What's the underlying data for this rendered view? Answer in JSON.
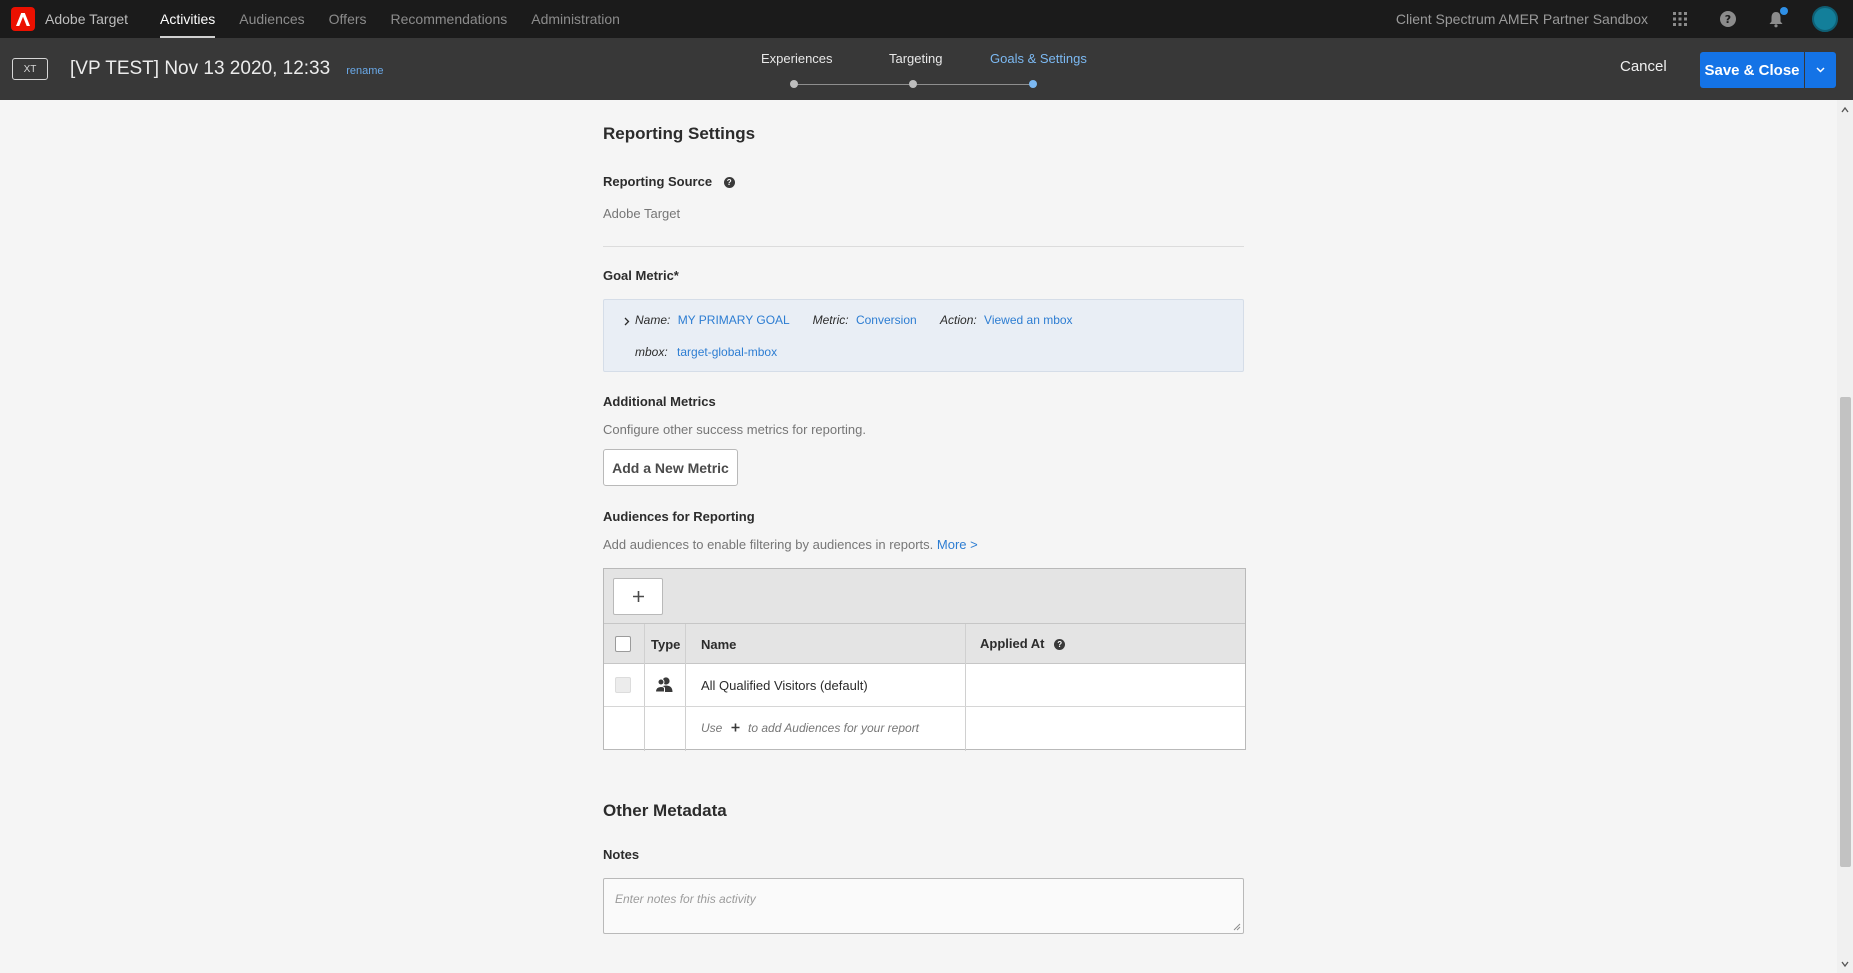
{
  "topbar": {
    "brand": "Adobe Target",
    "nav": [
      "Activities",
      "Audiences",
      "Offers",
      "Recommendations",
      "Administration"
    ],
    "sandbox": "Client Spectrum AMER Partner Sandbox"
  },
  "activity": {
    "badge": "XT",
    "title": "[VP TEST] Nov 13 2020, 12:33",
    "rename": "rename"
  },
  "steps": [
    "Experiences",
    "Targeting",
    "Goals & Settings"
  ],
  "actions": {
    "cancel": "Cancel",
    "save": "Save & Close"
  },
  "reporting": {
    "title": "Reporting Settings",
    "source_label": "Reporting Source",
    "source_value": "Adobe Target",
    "goal_label": "Goal Metric*",
    "goal": {
      "name_key": "Name:",
      "name_val": "MY PRIMARY GOAL",
      "metric_key": "Metric:",
      "metric_val": "Conversion",
      "action_key": "Action:",
      "action_val": "Viewed an mbox",
      "mbox_key": "mbox:",
      "mbox_val": "target-global-mbox"
    },
    "additional_label": "Additional Metrics",
    "additional_desc": "Configure other success metrics for reporting.",
    "add_metric": "Add a New Metric",
    "audiences_label": "Audiences for Reporting",
    "audiences_desc": "Add audiences to enable filtering by audiences in reports.",
    "audiences_more": "More >",
    "table": {
      "headers": [
        "Type",
        "Name",
        "Applied At"
      ],
      "rows": [
        {
          "name": "All Qualified Visitors (default)"
        }
      ],
      "hint_pre": "Use",
      "hint_post": "to add Audiences for your report"
    }
  },
  "metadata": {
    "title": "Other Metadata",
    "notes_label": "Notes",
    "notes_placeholder": "Enter notes for this activity"
  }
}
